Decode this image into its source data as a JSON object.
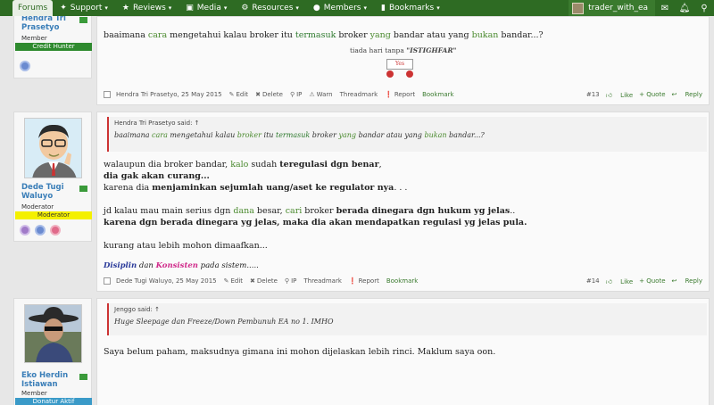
{
  "nav": {
    "items": [
      {
        "label": "Forums",
        "icon": ""
      },
      {
        "label": "Support",
        "icon": "✦"
      },
      {
        "label": "Reviews",
        "icon": "★"
      },
      {
        "label": "Media",
        "icon": "▣"
      },
      {
        "label": "Resources",
        "icon": "⚙"
      },
      {
        "label": "Members",
        "icon": "●"
      },
      {
        "label": "Bookmarks",
        "icon": "▮"
      }
    ],
    "username": "trader_with_ea",
    "colors": {
      "bar": "#2e6b23",
      "active_tab": "#e9efe6"
    }
  },
  "post1": {
    "author": "Hendra Tri Prasetyo",
    "role": "Member",
    "banner": "Credit Hunter",
    "banner_color": "#2e8a2e",
    "text_parts": [
      "baaimana ",
      "cara",
      " mengetahui kalau broker itu ",
      "termasuk",
      " broker ",
      "yang",
      " bandar atau yang ",
      "bukan",
      " bandar...?"
    ],
    "signature": "tiada hari tanpa",
    "signature_emph": "\"ISTIGHFAR\"",
    "sign_card_text": "Yes",
    "footer": {
      "author_date": "Hendra Tri Prasetyo, 25 May 2015",
      "actions": [
        "Edit",
        "Delete",
        "IP",
        "Warn",
        "Threadmark",
        "Report",
        "Bookmark"
      ],
      "number": "#13",
      "like": "Like",
      "quote": "+ Quote",
      "reply": "Reply"
    }
  },
  "post2": {
    "author": "Dede Tugi Waluyo",
    "role": "Moderator",
    "banner": "Moderator",
    "banner_color": "#f4f000",
    "quote_head": "Hendra Tri Prasetyo said: ↑",
    "quote_parts": [
      "baaimana ",
      "cara",
      " mengetahui kalau ",
      "broker",
      " itu ",
      "termasuk",
      " broker ",
      "yang",
      " bandar atau yang ",
      "bukan",
      " bandar...?"
    ],
    "line1_parts": [
      "walaupun dia broker bandar, ",
      "kalo",
      " sudah ",
      "teregulasi dgn benar",
      ","
    ],
    "line2": "dia gak akan curang...",
    "line3_parts": [
      "karena dia ",
      "menjaminkan sejumlah uang/aset ke regulator nya",
      ". . ."
    ],
    "line4_parts": [
      "jd kalau mau main serius dgn ",
      "dana",
      " besar, ",
      "cari",
      " broker ",
      "berada dinegara dgn hukum yg jelas",
      ".."
    ],
    "line5": "karena dgn berada dinegara yg jelas, maka dia akan mendapatkan regulasi yg jelas pula.",
    "line6": "kurang atau lebih mohon dimaafkan...",
    "sig_parts": [
      "Disiplin",
      " dan ",
      "Konsisten",
      " pada sistem....."
    ],
    "footer": {
      "author_date": "Dede Tugi Waluyo, 25 May 2015",
      "actions": [
        "Edit",
        "Delete",
        "IP",
        "Threadmark",
        "Report",
        "Bookmark"
      ],
      "number": "#14",
      "like": "Like",
      "quote": "+ Quote",
      "reply": "Reply"
    }
  },
  "post3": {
    "author": "Eko Herdin Istiawan",
    "role": "Member",
    "banner": "Donatur Aktif",
    "banner_color": "#3a9ac8",
    "quote_head": "Jenggo said: ↑",
    "quote_text": "Huge Sleepage dan Freeze/Down Pembunuh EA no 1. IMHO",
    "text": "Saya belum paham, maksudnya gimana ini mohon dijelaskan lebih rinci. Maklum saya oon."
  }
}
